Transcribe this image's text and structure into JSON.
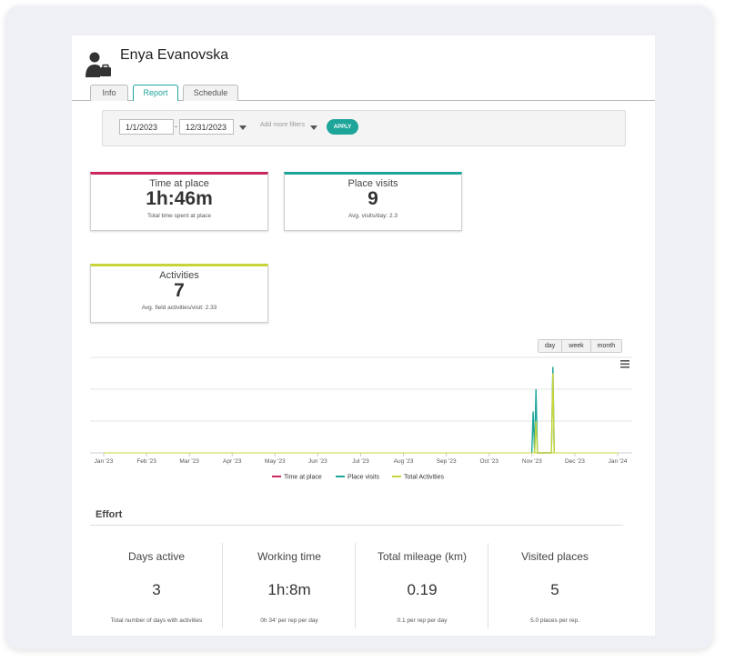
{
  "user": {
    "name": "Enya Evanovska",
    "avatar_icon": "person-briefcase-icon"
  },
  "tabs": [
    {
      "label": "Info",
      "active": false
    },
    {
      "label": "Report",
      "active": true
    },
    {
      "label": "Schedule",
      "active": false
    }
  ],
  "filters": {
    "start_date": "1/1/2023",
    "separator": "-",
    "end_date": "12/31/2023",
    "more_filters_label": "Add more filters",
    "apply_label": "APPLY"
  },
  "cards": {
    "time_at_place": {
      "title": "Time at place",
      "value": "1h:46m",
      "sub": "Total time spent at place",
      "color": "#c9285f"
    },
    "place_visits": {
      "title": "Place visits",
      "value": "9",
      "sub": "Avg. visits/day: 2.3",
      "color": "#1ea59a"
    },
    "activities": {
      "title": "Activities",
      "value": "7",
      "sub": "Avg. field activities/visit: 2.33",
      "color": "#c8d53a"
    }
  },
  "range_buttons": [
    "day",
    "week",
    "month"
  ],
  "chart_data": {
    "type": "line",
    "categories": [
      "Jan '23",
      "Feb '23",
      "Mar '23",
      "Apr '23",
      "May '23",
      "Jun '23",
      "Jul '23",
      "Aug '23",
      "Sep '23",
      "Oct '23",
      "Nov '23",
      "Dec '23",
      "Jan '24"
    ],
    "ylim": [
      0,
      3
    ],
    "grid": true,
    "legend": "bottom",
    "menu_icon": "hamburger-icon",
    "series": [
      {
        "name": "Time at place",
        "color": "#c9285f",
        "points": []
      },
      {
        "name": "Place visits",
        "color": "#1ea59a",
        "points": [
          [
            "2023-11-01",
            0
          ],
          [
            "2023-11-02",
            1.3
          ],
          [
            "2023-11-03",
            0
          ],
          [
            "2023-11-04",
            2
          ],
          [
            "2023-11-05",
            0
          ],
          [
            "2023-11-15",
            0
          ],
          [
            "2023-11-16",
            2.7
          ],
          [
            "2023-11-17",
            0
          ]
        ]
      },
      {
        "name": "Total Activities",
        "color": "#c8d53a",
        "points": [
          [
            "2023-11-03",
            0
          ],
          [
            "2023-11-04",
            1
          ],
          [
            "2023-11-05",
            0
          ],
          [
            "2023-11-15",
            0
          ],
          [
            "2023-11-16",
            2.5
          ],
          [
            "2023-11-17",
            0
          ]
        ]
      }
    ]
  },
  "effort": {
    "title": "Effort",
    "stats": [
      {
        "title": "Days active",
        "value": "3",
        "sub": "Total number of days with activities"
      },
      {
        "title": "Working time",
        "value": "1h:8m",
        "sub": "0h 34' per rep per day"
      },
      {
        "title": "Total mileage (km)",
        "value": "0.19",
        "sub": "0.1 per rep per day"
      },
      {
        "title": "Visited places",
        "value": "5",
        "sub": "5.0 places per rep."
      }
    ]
  }
}
